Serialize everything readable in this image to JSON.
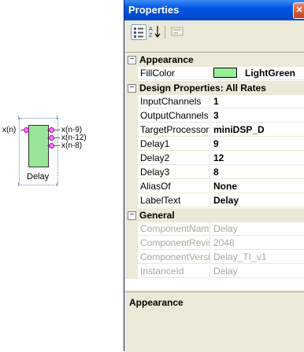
{
  "diagram": {
    "input_pin": "x(n)",
    "outputs": [
      "x(n-9)",
      "x(n-12)",
      "x(n-8)"
    ],
    "block_label": "Delay",
    "block_color": "#99e699"
  },
  "window": {
    "title": "Properties",
    "close_glyph": "✕"
  },
  "toolbar": {
    "categorized_icon": "categorized-view-icon",
    "alphabetical_icon": "alphabetical-sort-icon",
    "pages_icon": "property-pages-icon"
  },
  "categories": {
    "appearance": "Appearance",
    "design": "Design Properties: All Rates",
    "general": "General"
  },
  "appearance": {
    "fillcolor_name": "FillColor",
    "fillcolor_value": "LightGreen",
    "fillcolor_swatch": "#99ee99"
  },
  "design": [
    {
      "name": "InputChannels",
      "value": "1"
    },
    {
      "name": "OutputChannels",
      "value": "3"
    },
    {
      "name": "TargetProcessor",
      "value": "miniDSP_D"
    },
    {
      "name": "Delay1",
      "value": "9"
    },
    {
      "name": "Delay2",
      "value": "12"
    },
    {
      "name": "Delay3",
      "value": "8"
    },
    {
      "name": "AliasOf",
      "value": "None"
    },
    {
      "name": "LabelText",
      "value": "Delay"
    }
  ],
  "general": [
    {
      "name": "ComponentName",
      "value": "Delay"
    },
    {
      "name": "ComponentRevision",
      "value": "2048"
    },
    {
      "name": "ComponentVersion",
      "value": "Delay_TI_v1"
    },
    {
      "name": "InstanceId",
      "value": "Delay"
    }
  ],
  "description": {
    "title": "Appearance"
  }
}
